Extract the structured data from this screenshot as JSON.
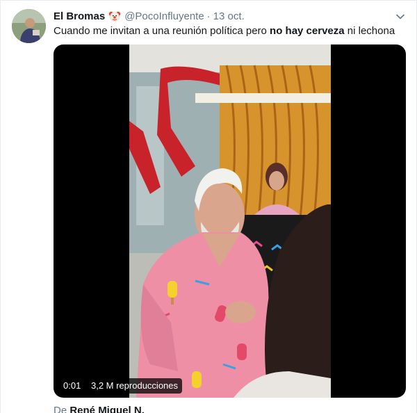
{
  "tweet": {
    "author_name": "El Bromas",
    "author_emoji_icon": "clown-face-icon",
    "handle": "@PocoInfluyente",
    "separator": "·",
    "date": "13 oct.",
    "text_part1": "Cuando me invitan a una reunión política pero ",
    "text_bold": "no hay cerveza",
    "text_part2": " ni lechona",
    "menu_icon": "chevron-down-icon"
  },
  "video": {
    "elapsed": "0:01",
    "views": "3,2 M reproducciones"
  },
  "footer": {
    "prefix": "De ",
    "source_name": "René Miguel N."
  },
  "colors": {
    "primary_text": "#14171a",
    "secondary_text": "#657786",
    "border": "#e6ecf0",
    "media_background": "#000000"
  }
}
